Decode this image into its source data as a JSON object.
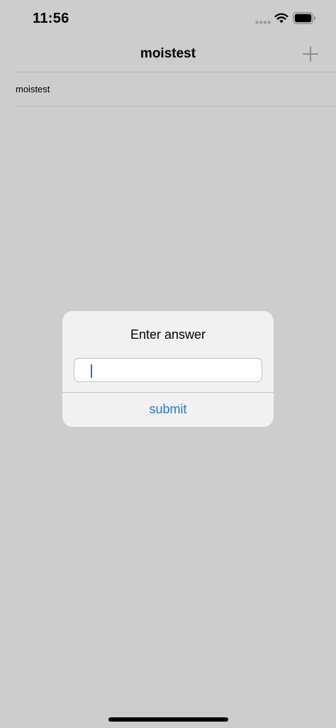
{
  "status_bar": {
    "time": "11:56",
    "signal_icon": "signal-dots-icon",
    "wifi_icon": "wifi-icon",
    "battery_icon": "battery-icon"
  },
  "nav": {
    "title": "moistest",
    "add_icon": "plus-icon"
  },
  "list": {
    "items": [
      {
        "label": "moistest"
      }
    ]
  },
  "alert": {
    "title": "Enter answer",
    "input_value": "",
    "submit_label": "submit"
  },
  "colors": {
    "background": "#cdcdcd",
    "alert_background": "#f1f1f1",
    "accent": "#1c7cd5"
  }
}
